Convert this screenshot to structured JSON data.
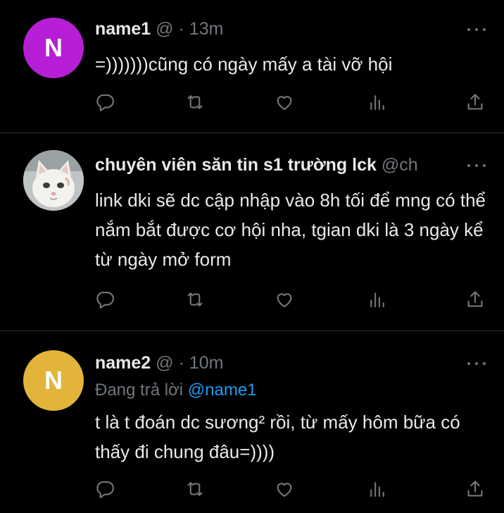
{
  "tweets": [
    {
      "avatar_letter": "N",
      "avatar_color": "#b71fd6",
      "name": "name1",
      "handle": "@",
      "separator": "·",
      "time": "13m",
      "reply_prefix": "",
      "reply_handle": "",
      "text": "=)))))))cũng có ngày mấy a tài vỡ hội"
    },
    {
      "avatar_letter": "",
      "avatar_color": "#cfd3d6",
      "name": "chuyên viên săn tin s1 trường lck",
      "handle": "@ch",
      "separator": "",
      "time": "",
      "reply_prefix": "",
      "reply_handle": "",
      "text": "link dki sẽ dc cập nhập vào 8h tối để mng có thể nắm bắt được cơ hội nha, tgian dki là 3 ngày kể từ ngày mở form"
    },
    {
      "avatar_letter": "N",
      "avatar_color": "#e2b53a",
      "name": "name2",
      "handle": "@",
      "separator": "·",
      "time": "10m",
      "reply_prefix": "Đang trả lời",
      "reply_handle": "@name1",
      "text": "t là t đoán dc sương² rồi, từ mấy hôm bữa có thấy đi chung đâu=))))"
    }
  ],
  "icons": [
    "reply-icon",
    "retweet-icon",
    "like-icon",
    "views-icon",
    "share-icon",
    "more-icon"
  ],
  "colors": {
    "background": "#000000",
    "text": "#e7e9ea",
    "muted": "#71767b",
    "link": "#1d9bf0",
    "divider": "#2f3336"
  }
}
